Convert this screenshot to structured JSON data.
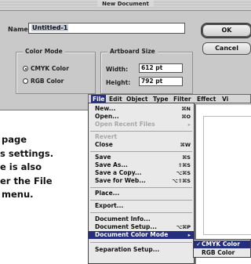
{
  "dialog": {
    "title": "New Document",
    "name_label": "Name:",
    "name_value": "Untitled-1",
    "ok_label": "OK",
    "cancel_label": "Cancel",
    "color_mode": {
      "title": "Color Mode",
      "options": [
        {
          "label": "CMYK Color",
          "selected": true
        },
        {
          "label": "RGB Color",
          "selected": false
        }
      ]
    },
    "artboard": {
      "title": "Artboard Size",
      "width_label": "Width:",
      "width_value": "612 pt",
      "height_label": "Height:",
      "height_value": "792 pt"
    }
  },
  "caption": {
    "lines": [
      "page",
      "s settings.",
      "e is also",
      "er the File",
      "menu."
    ]
  },
  "menubar": {
    "items": [
      "File",
      "Edit",
      "Object",
      "Type",
      "Filter",
      "Effect",
      "Vi"
    ]
  },
  "file_menu": {
    "items": [
      {
        "label": "New...",
        "shortcut": "⌘N",
        "disabled": false
      },
      {
        "label": "Open...",
        "shortcut": "⌘O",
        "disabled": false
      },
      {
        "label": "Open Recent Files",
        "shortcut": "▸",
        "disabled": true
      },
      {
        "label": "Revert",
        "shortcut": "",
        "disabled": true
      },
      {
        "label": "Close",
        "shortcut": "⌘W",
        "disabled": false
      },
      {
        "label": "Save",
        "shortcut": "⌘S",
        "disabled": false
      },
      {
        "label": "Save As...",
        "shortcut": "⇧⌘S",
        "disabled": false
      },
      {
        "label": "Save a Copy...",
        "shortcut": "⌥⌘S",
        "disabled": false
      },
      {
        "label": "Save for Web...",
        "shortcut": "⌥⇧⌘S",
        "disabled": false
      },
      {
        "label": "Place...",
        "shortcut": "",
        "disabled": false
      },
      {
        "label": "Export...",
        "shortcut": "",
        "disabled": false
      },
      {
        "label": "Document Info...",
        "shortcut": "",
        "disabled": false
      },
      {
        "label": "Document Setup...",
        "shortcut": "⌥⌘P",
        "disabled": false
      },
      {
        "label": "Document Color Mode",
        "shortcut": "▸",
        "disabled": false
      },
      {
        "label": "Separation Setup...",
        "shortcut": "",
        "disabled": false
      }
    ]
  },
  "color_submenu": {
    "items": [
      {
        "label": "CMYK Color",
        "checked": true
      },
      {
        "label": "RGB Color",
        "checked": false
      }
    ]
  }
}
